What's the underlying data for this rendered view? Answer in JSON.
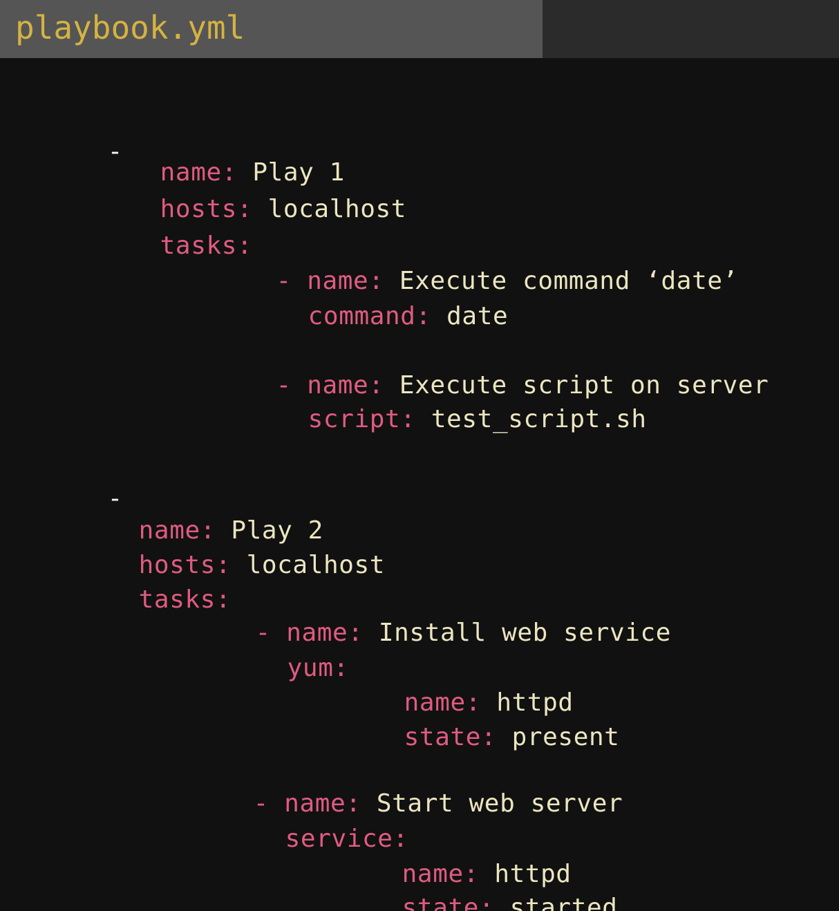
{
  "tab": {
    "filename": "playbook.yml"
  },
  "code": {
    "play1": {
      "dash": "-",
      "name_key": "name:",
      "name_val": "Play 1",
      "hosts_key": "hosts:",
      "hosts_val": "localhost",
      "tasks_key": "tasks:",
      "task1": {
        "dash": "-",
        "name_key": "name:",
        "name_val": "Execute command ‘date’",
        "cmd_key": "command:",
        "cmd_val": "date"
      },
      "task2": {
        "dash": "-",
        "name_key": "name:",
        "name_val": "Execute script on server",
        "script_key": "script:",
        "script_val": "test_script.sh"
      }
    },
    "play2": {
      "dash": "-",
      "name_key": "name:",
      "name_val": "Play 2",
      "hosts_key": "hosts:",
      "hosts_val": "localhost",
      "tasks_key": "tasks:",
      "task1": {
        "dash": "-",
        "name_key": "name:",
        "name_val": "Install web service",
        "module_key": "yum:",
        "p_name_key": "name:",
        "p_name_val": "httpd",
        "p_state_key": "state:",
        "p_state_val": "present"
      },
      "task2": {
        "dash": "-",
        "name_key": "name:",
        "name_val": "Start web server",
        "module_key": "service:",
        "p_name_key": "name:",
        "p_name_val": "httpd",
        "p_state_key": "state:",
        "p_state_val": "started"
      }
    }
  },
  "colors": {
    "background": "#111111",
    "tab_active": "#555555",
    "tab_bar": "#2b2b2b",
    "filename": "#d5b342",
    "key": "#e05b82",
    "value": "#ece6c0"
  }
}
